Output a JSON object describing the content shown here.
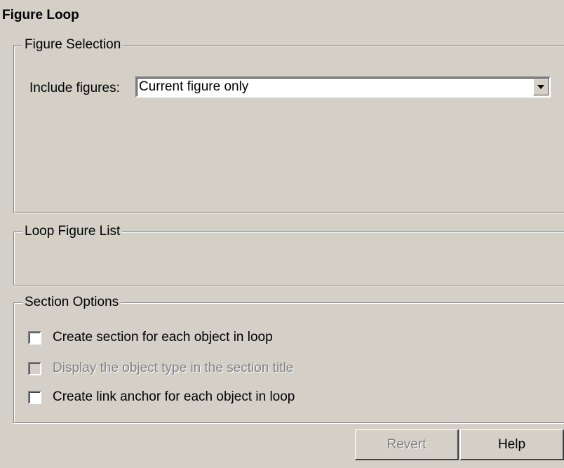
{
  "panel": {
    "title": "Figure Loop"
  },
  "figure_selection": {
    "label": "Figure Selection",
    "include_label": "Include figures:",
    "include_value": "Current figure only"
  },
  "loop_figure_list": {
    "label": "Loop Figure List"
  },
  "section_options": {
    "label": "Section Options",
    "options": [
      {
        "label": "Create section for each object in loop",
        "checked": false,
        "enabled": true
      },
      {
        "label": "Display the object type in the section title",
        "checked": false,
        "enabled": false
      },
      {
        "label": "Create link anchor for each object in loop",
        "checked": false,
        "enabled": true
      }
    ]
  },
  "buttons": {
    "revert": "Revert",
    "help": "Help"
  }
}
